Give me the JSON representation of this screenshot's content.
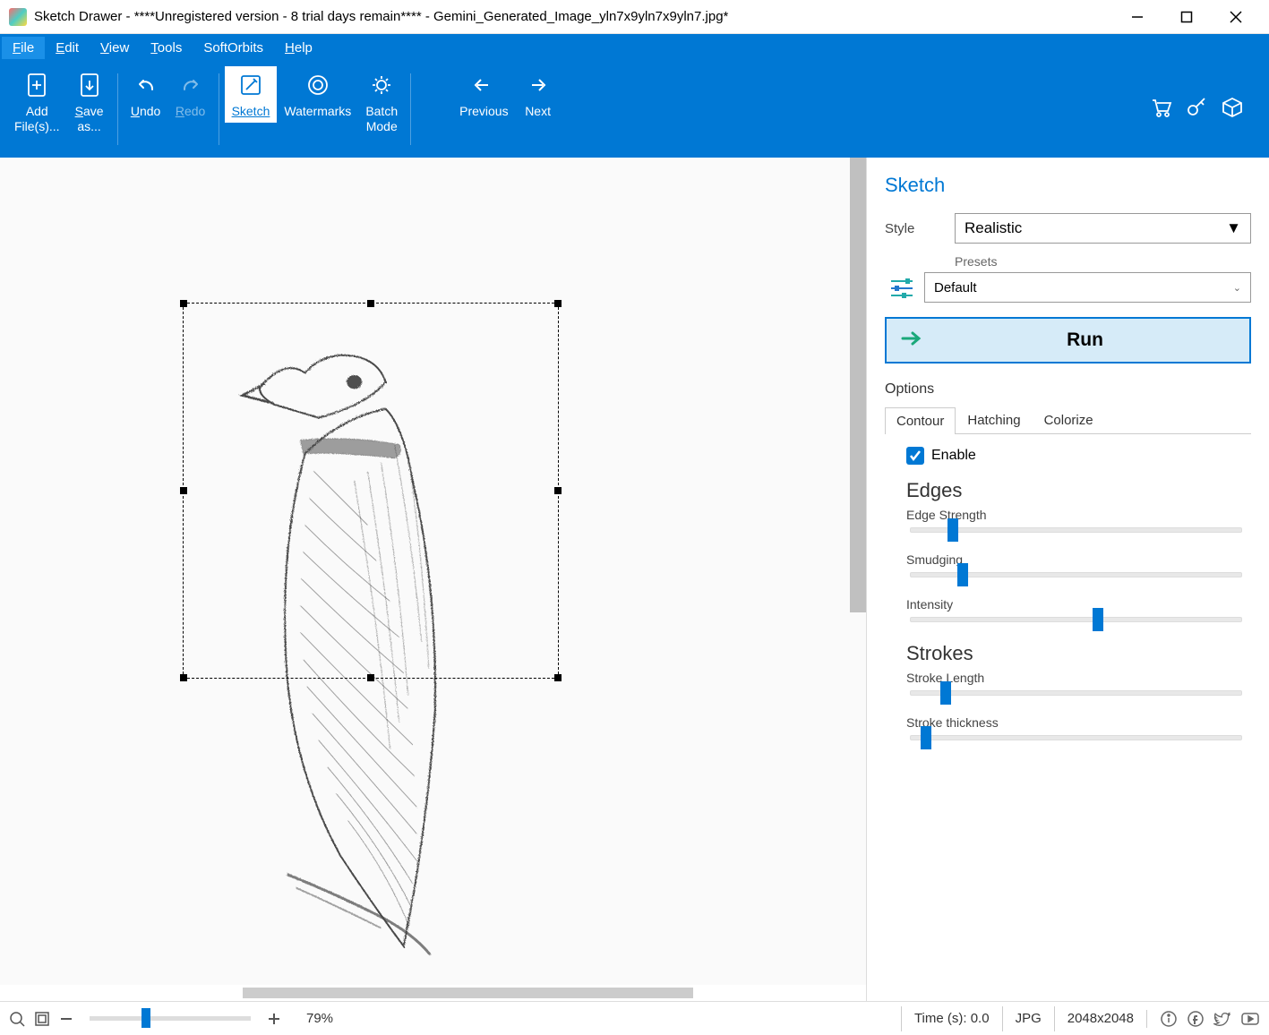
{
  "window": {
    "title": "Sketch Drawer - ****Unregistered version - 8 trial days remain**** - Gemini_Generated_Image_yln7x9yln7x9yln7.jpg*"
  },
  "menu": {
    "file": "File",
    "edit": "Edit",
    "view": "View",
    "tools": "Tools",
    "softorbits": "SoftOrbits",
    "help": "Help"
  },
  "toolbar": {
    "add_files": "Add File(s)...",
    "save_as": "Save as...",
    "undo": "Undo",
    "redo": "Redo",
    "sketch": "Sketch",
    "watermarks": "Watermarks",
    "batch_mode": "Batch Mode",
    "previous": "Previous",
    "next": "Next"
  },
  "panel": {
    "title": "Sketch",
    "style_label": "Style",
    "style_value": "Realistic",
    "presets_label": "Presets",
    "preset_value": "Default",
    "run": "Run",
    "options": "Options",
    "tabs": {
      "contour": "Contour",
      "hatching": "Hatching",
      "colorize": "Colorize"
    },
    "enable": "Enable",
    "edges_section": "Edges",
    "edge_strength": "Edge Strength",
    "smudging": "Smudging",
    "intensity": "Intensity",
    "strokes_section": "Strokes",
    "stroke_length": "Stroke Length",
    "stroke_thickness": "Stroke thickness",
    "sliders": {
      "edge_strength": 11,
      "smudging": 14,
      "intensity": 55,
      "stroke_length": 9,
      "stroke_thickness": 3
    }
  },
  "status": {
    "zoom": "79%",
    "time": "Time (s): 0.0",
    "format": "JPG",
    "dimensions": "2048x2048"
  }
}
